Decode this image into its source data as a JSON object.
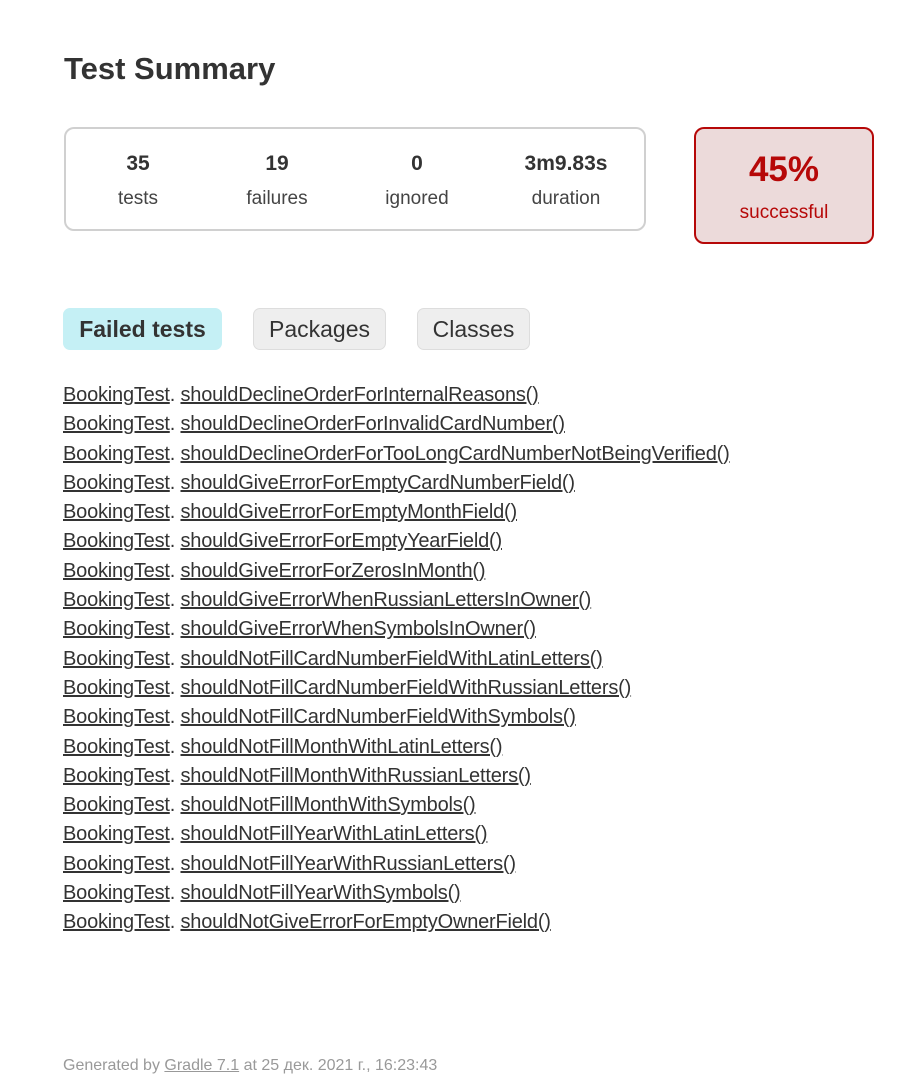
{
  "page": {
    "title": "Test Summary"
  },
  "summary": {
    "tests": {
      "value": "35",
      "label": "tests"
    },
    "failures": {
      "value": "19",
      "label": "failures"
    },
    "ignored": {
      "value": "0",
      "label": "ignored"
    },
    "duration": {
      "value": "3m9.83s",
      "label": "duration"
    }
  },
  "success_rate": {
    "value": "45%",
    "label": "successful",
    "color": "#b60808",
    "background": "#ecdada"
  },
  "tabs": [
    {
      "label": "Failed tests",
      "active": true
    },
    {
      "label": "Packages",
      "active": false
    },
    {
      "label": "Classes",
      "active": false
    }
  ],
  "failed_tests": [
    {
      "class": "BookingTest",
      "method": "shouldDeclineOrderForInternalReasons()"
    },
    {
      "class": "BookingTest",
      "method": "shouldDeclineOrderForInvalidCardNumber()"
    },
    {
      "class": "BookingTest",
      "method": "shouldDeclineOrderForTooLongCardNumberNotBeingVerified()"
    },
    {
      "class": "BookingTest",
      "method": "shouldGiveErrorForEmptyCardNumberField()"
    },
    {
      "class": "BookingTest",
      "method": "shouldGiveErrorForEmptyMonthField()"
    },
    {
      "class": "BookingTest",
      "method": "shouldGiveErrorForEmptyYearField()"
    },
    {
      "class": "BookingTest",
      "method": "shouldGiveErrorForZerosInMonth()"
    },
    {
      "class": "BookingTest",
      "method": "shouldGiveErrorWhenRussianLettersInOwner()"
    },
    {
      "class": "BookingTest",
      "method": "shouldGiveErrorWhenSymbolsInOwner()"
    },
    {
      "class": "BookingTest",
      "method": "shouldNotFillCardNumberFieldWithLatinLetters()"
    },
    {
      "class": "BookingTest",
      "method": "shouldNotFillCardNumberFieldWithRussianLetters()"
    },
    {
      "class": "BookingTest",
      "method": "shouldNotFillCardNumberFieldWithSymbols()"
    },
    {
      "class": "BookingTest",
      "method": "shouldNotFillMonthWithLatinLetters()"
    },
    {
      "class": "BookingTest",
      "method": "shouldNotFillMonthWithRussianLetters()"
    },
    {
      "class": "BookingTest",
      "method": "shouldNotFillMonthWithSymbols()"
    },
    {
      "class": "BookingTest",
      "method": "shouldNotFillYearWithLatinLetters()"
    },
    {
      "class": "BookingTest",
      "method": "shouldNotFillYearWithRussianLetters()"
    },
    {
      "class": "BookingTest",
      "method": "shouldNotFillYearWithSymbols()"
    },
    {
      "class": "BookingTest",
      "method": "shouldNotGiveErrorForEmptyOwnerField()"
    }
  ],
  "footer": {
    "prefix": "Generated by ",
    "link": "Gradle 7.1",
    "suffix": " at 25 дек. 2021 г., 16:23:43"
  }
}
